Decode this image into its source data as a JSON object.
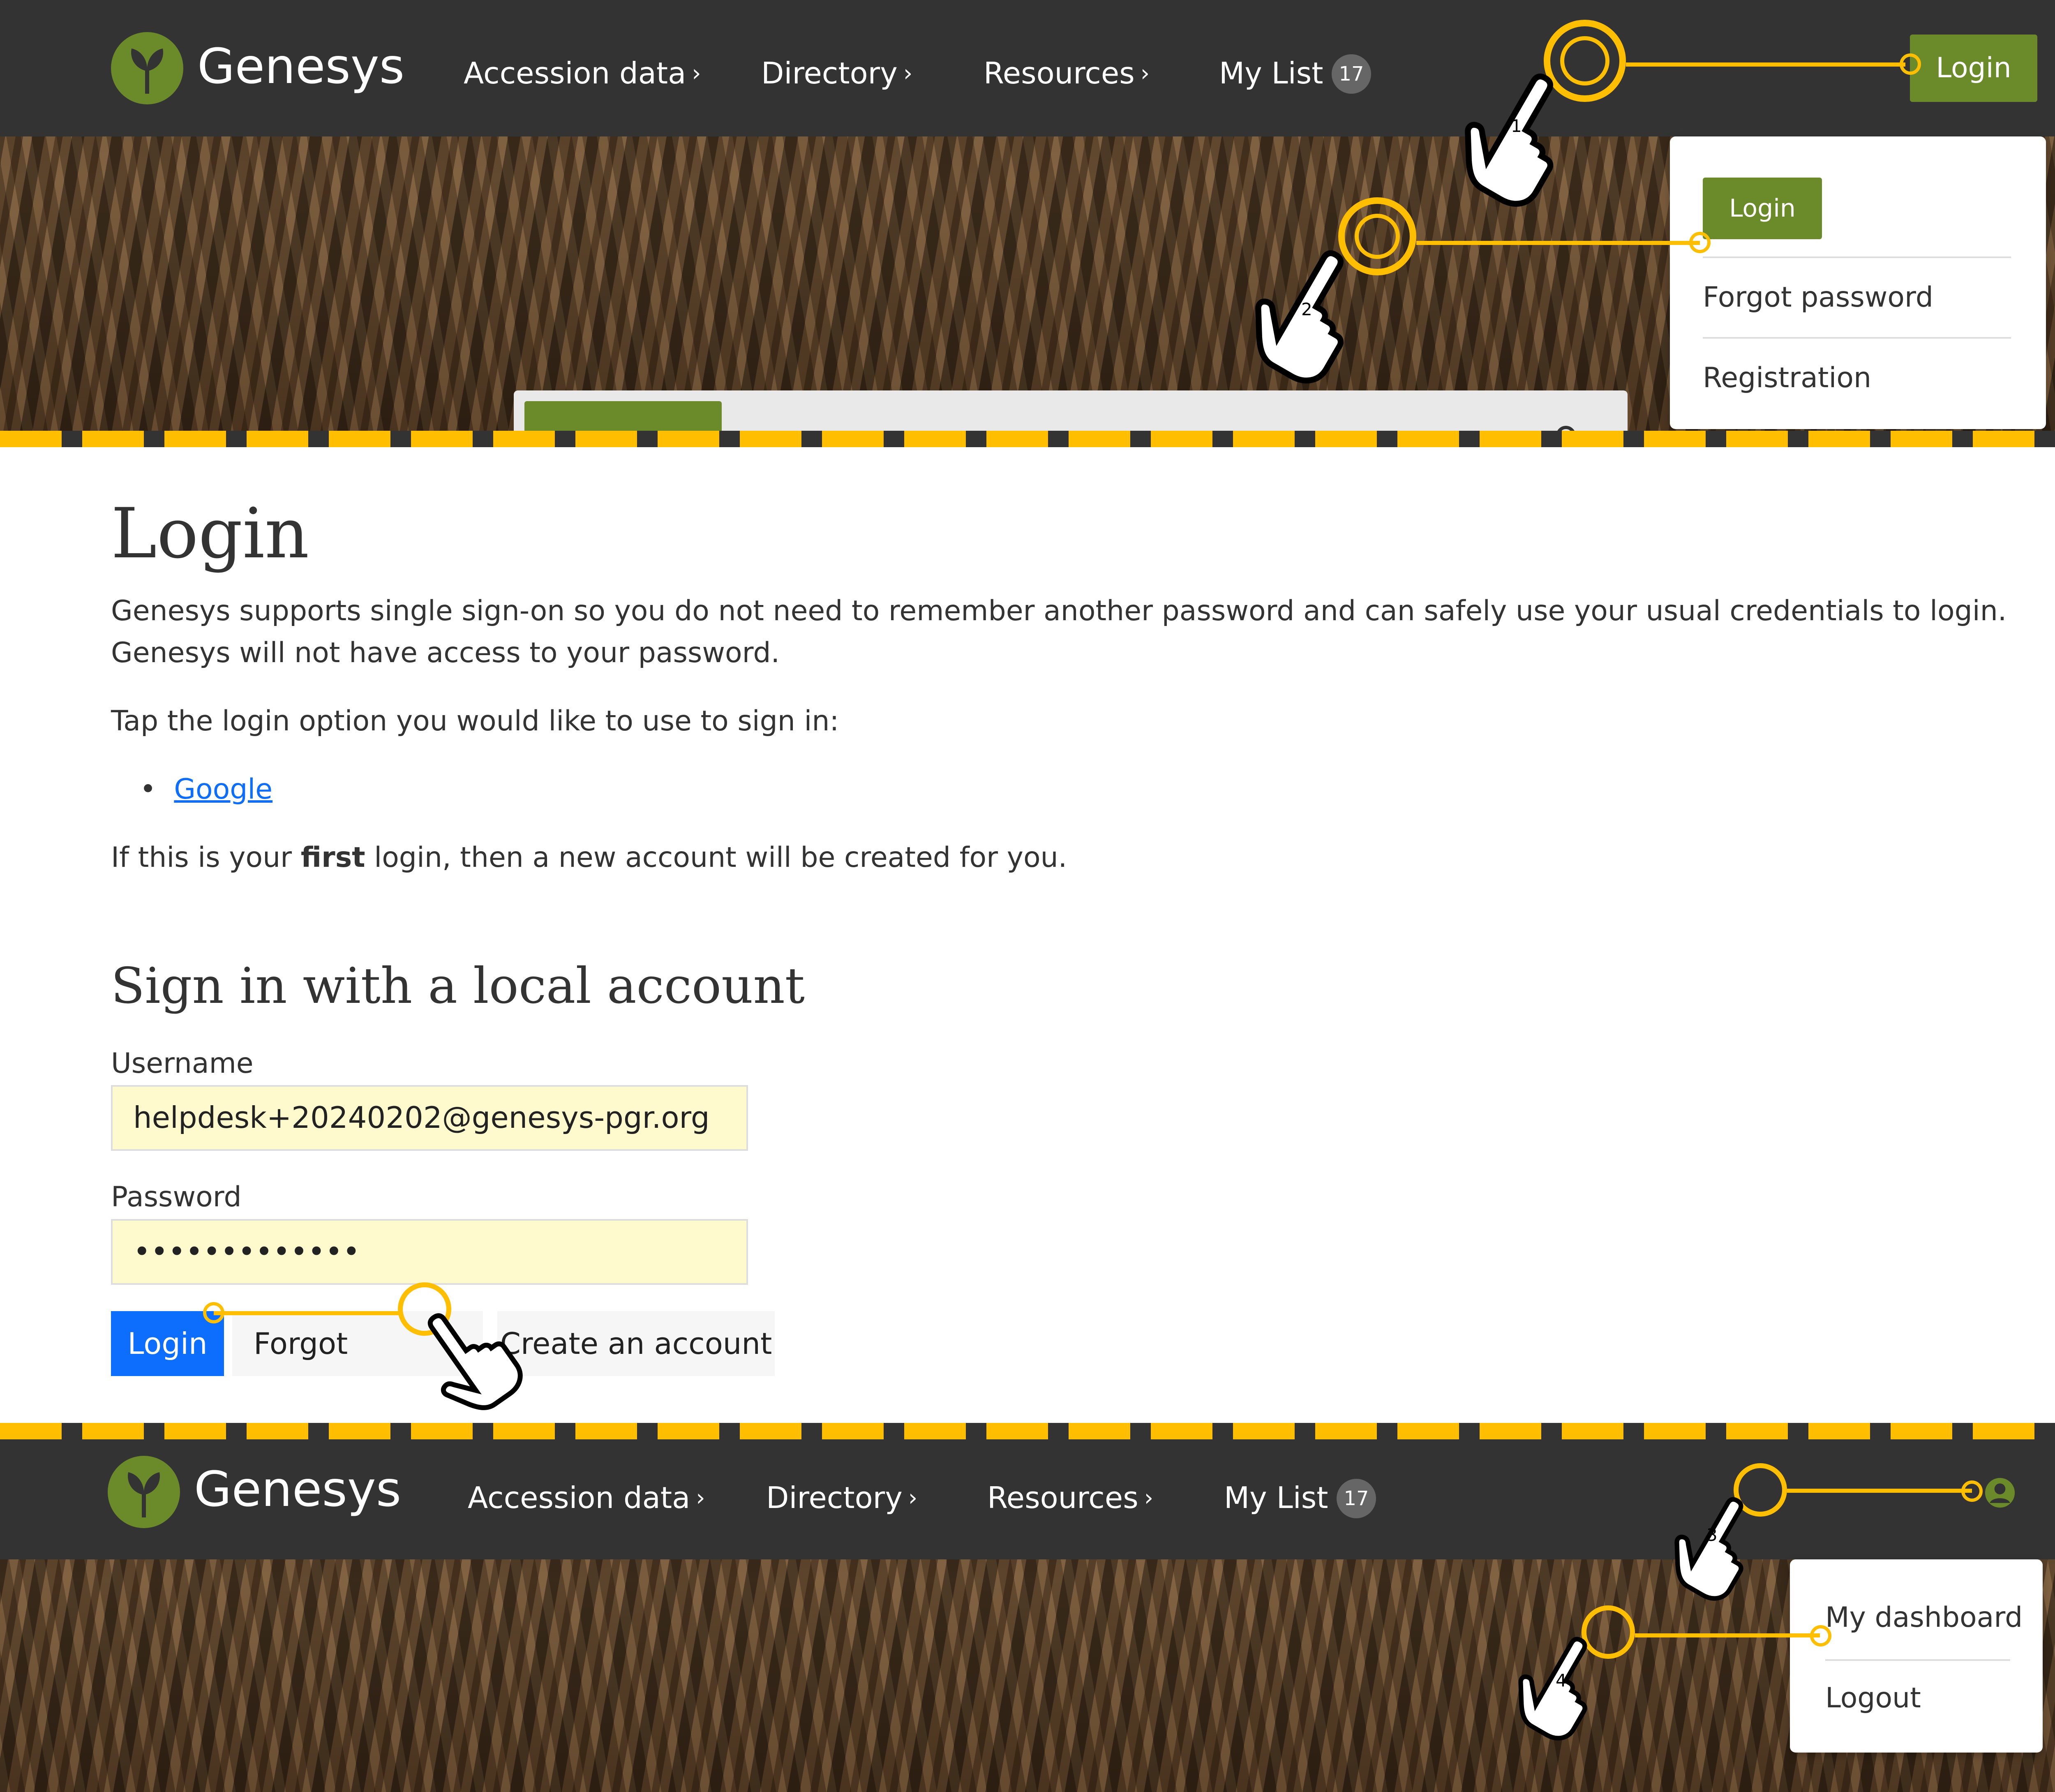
{
  "brand": {
    "name": "Genesys",
    "logo_color": "#6b8a2a"
  },
  "nav": {
    "items": [
      "Accession data",
      "Directory",
      "Resources"
    ],
    "chevron": "›",
    "mylist_label": "My List",
    "mylist_count": "17"
  },
  "header_login": {
    "label": "Login"
  },
  "login_dropdown": {
    "login_label": "Login",
    "forgot_label": "Forgot password",
    "registration_label": "Registration"
  },
  "login_page": {
    "title": "Login",
    "intro": "Genesys supports single sign-on so you do not need to remember another password and can safely use your usual credentials to login. Genesys will not have access to your password.",
    "tap_prompt": "Tap the login option you would like to use to sign in:",
    "providers": [
      "Google"
    ],
    "first_login_pre": "If this is your ",
    "first_login_bold": "first",
    "first_login_post": " login, then a new account will be created for you.",
    "local_heading": "Sign in with a local account",
    "username_label": "Username",
    "username_value": "helpdesk+20240202@genesys-pgr.org",
    "password_label": "Password",
    "password_value": "•••••••••••••",
    "login_button": "Login",
    "forgot_button": "Forgot password",
    "create_button": "Create an account"
  },
  "user_dropdown": {
    "dashboard_label": "My dashboard",
    "logout_label": "Logout"
  },
  "steps": [
    "1",
    "2",
    "3",
    "4"
  ],
  "colors": {
    "accent": "#ffbe00",
    "primary": "#0d6efd",
    "topbar": "#333333",
    "green": "#6b8a2a"
  }
}
